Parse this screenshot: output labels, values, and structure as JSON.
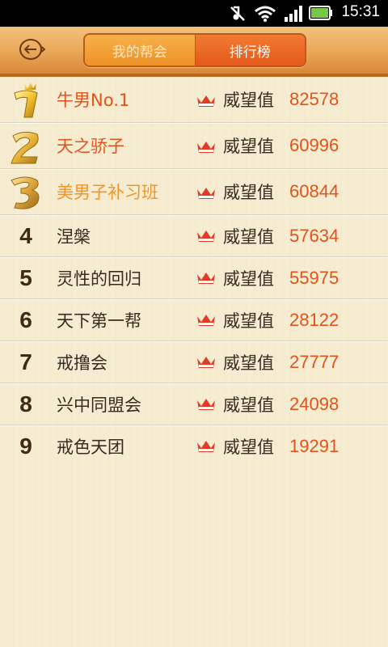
{
  "status_bar": {
    "time": "15:31",
    "icons": [
      "mute-icon",
      "wifi-icon",
      "signal-icon",
      "battery-icon"
    ]
  },
  "header": {
    "back_icon": "back-arrow-icon",
    "tabs": [
      {
        "label": "我的帮会",
        "active": false
      },
      {
        "label": "排行榜",
        "active": true
      }
    ]
  },
  "ranking": {
    "prestige_label": "威望值",
    "rows": [
      {
        "rank": "1",
        "name": "牛男No.1",
        "value": "82578",
        "medal": "gold"
      },
      {
        "rank": "2",
        "name": "天之骄子",
        "value": "60996",
        "medal": "silver"
      },
      {
        "rank": "3",
        "name": "美男子补习班",
        "value": "60844",
        "medal": "bronze"
      },
      {
        "rank": "4",
        "name": "涅槃",
        "value": "57634"
      },
      {
        "rank": "5",
        "name": "灵性的回归",
        "value": "55975"
      },
      {
        "rank": "6",
        "name": "天下第一帮",
        "value": "28122"
      },
      {
        "rank": "7",
        "name": "戒撸会",
        "value": "27777"
      },
      {
        "rank": "8",
        "name": "兴中同盟会",
        "value": "24098"
      },
      {
        "rank": "9",
        "name": "戒色天团",
        "value": "19291"
      }
    ]
  },
  "colors": {
    "accent": "#e0541b",
    "header": "#e9a657",
    "background": "#f6ecd2"
  }
}
